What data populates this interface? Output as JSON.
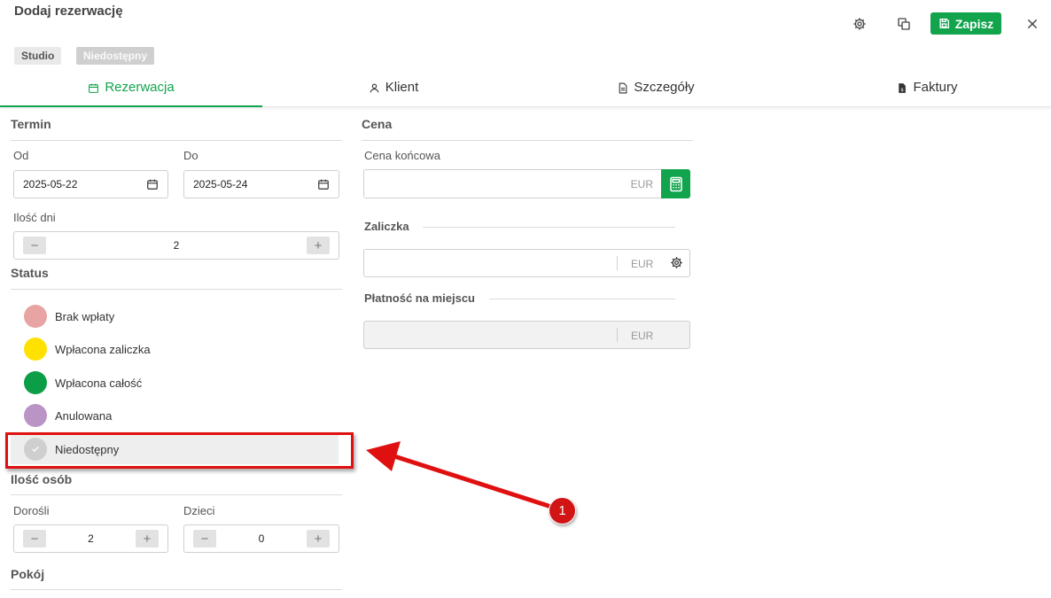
{
  "header": {
    "title": "Dodaj rezerwację",
    "save_label": "Zapisz",
    "tags": [
      "Studio",
      "Niedostępny"
    ]
  },
  "tabs": [
    {
      "label": "Rezerwacja",
      "icon": "calendar-icon",
      "active": true
    },
    {
      "label": "Klient",
      "icon": "user-icon",
      "active": false
    },
    {
      "label": "Szczegóły",
      "icon": "document-icon",
      "active": false
    },
    {
      "label": "Faktury",
      "icon": "invoice-icon",
      "active": false
    }
  ],
  "termin": {
    "title": "Termin",
    "from_label": "Od",
    "from_value": "2025-05-22",
    "to_label": "Do",
    "to_value": "2025-05-24",
    "days_label": "Ilość dni",
    "days_value": "2"
  },
  "status": {
    "title": "Status",
    "items": [
      {
        "label": "Brak wpłaty",
        "color": "#e8a3a3"
      },
      {
        "label": "Wpłacona zaliczka",
        "color": "#ffe100"
      },
      {
        "label": "Wpłacona całość",
        "color": "#0c9e46"
      },
      {
        "label": "Anulowana",
        "color": "#bb94c6"
      },
      {
        "label": "Niedostępny",
        "color": "#cfcfcf",
        "selected": true
      }
    ]
  },
  "people": {
    "title": "Ilość osób",
    "adults_label": "Dorośli",
    "adults_value": "2",
    "children_label": "Dzieci",
    "children_value": "0"
  },
  "room": {
    "title": "Pokój"
  },
  "price": {
    "title": "Cena",
    "final_label": "Cena końcowa",
    "final_currency": "EUR",
    "deposit_label": "Zaliczka",
    "deposit_currency": "EUR",
    "onsite_label": "Płatność na miejscu",
    "onsite_currency": "EUR"
  },
  "annotation": {
    "number": "1",
    "color": "#e01010"
  }
}
